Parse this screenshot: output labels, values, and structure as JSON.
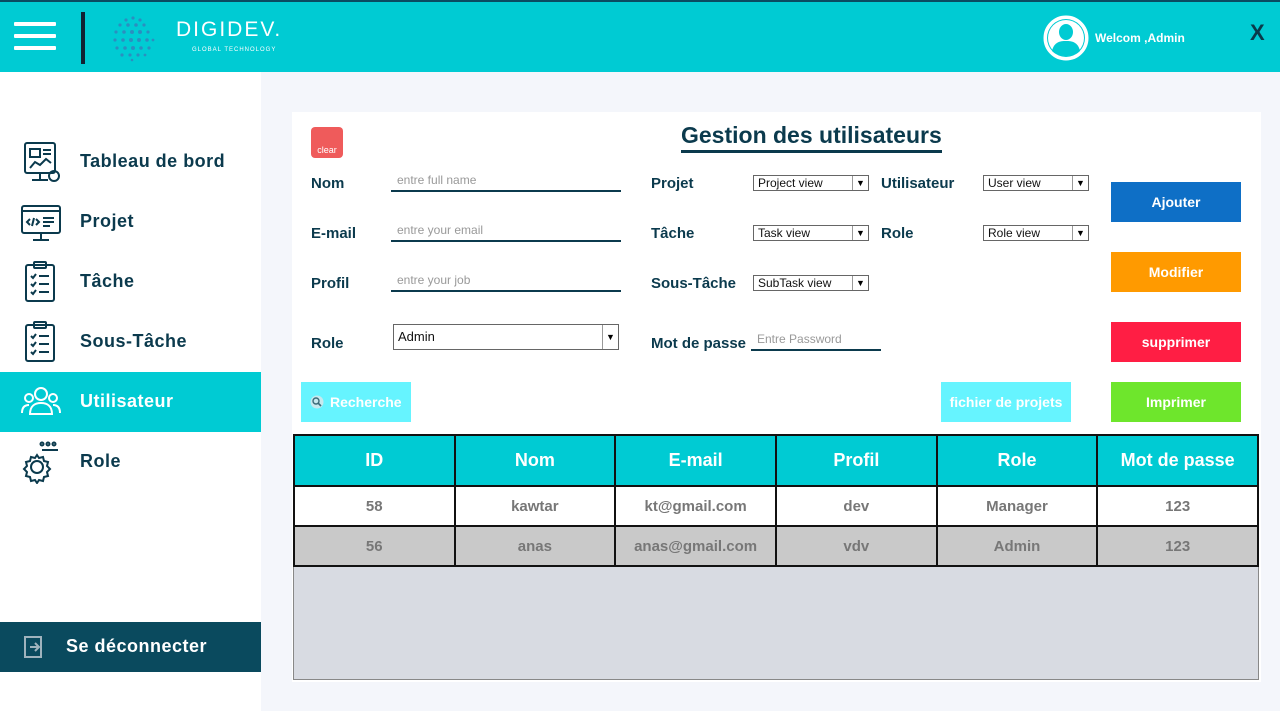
{
  "header": {
    "brand": "DIGIDEV.",
    "brand_sub": "GLOBAL TECHNOLOGY",
    "welcome": "Welcom ,Admin",
    "close": "X",
    "accent_color": "#00cbd3"
  },
  "sidebar": {
    "items": [
      {
        "label": "Tableau de bord",
        "icon": "dashboard-icon"
      },
      {
        "label": "Projet",
        "icon": "monitor-code-icon"
      },
      {
        "label": "Tâche",
        "icon": "checklist-icon"
      },
      {
        "label": "Sous-Tâche",
        "icon": "checklist-icon"
      },
      {
        "label": "Utilisateur",
        "icon": "users-icon",
        "active": true
      },
      {
        "label": "Role",
        "icon": "gear-icon"
      }
    ],
    "logout": "Se déconnecter"
  },
  "form": {
    "title": "Gestion des utilisateurs",
    "clear": "clear",
    "nom_label": "Nom",
    "nom_placeholder": "entre full name",
    "email_label": "E-mail",
    "email_placeholder": "entre your email",
    "profil_label": "Profil",
    "profil_placeholder": "entre your job",
    "role_label": "Role",
    "role_value": "Admin",
    "projet_label": "Projet",
    "projet_value": "Project view",
    "tache_label": "Tâche",
    "tache_value": "Task view",
    "soustache_label": "Sous-Tâche",
    "soustache_value": "SubTask view",
    "utilisateur_label": "Utilisateur",
    "utilisateur_value": "User view",
    "role2_label": "Role",
    "role2_value": "Role view",
    "password_label": "Mot de passe",
    "password_placeholder": "Entre Password"
  },
  "buttons": {
    "ajouter": "Ajouter",
    "modifier": "Modifier",
    "supprimer": "supprimer",
    "imprimer": "Imprimer",
    "recherche": "Recherche",
    "fichier": "fichier de projets"
  },
  "table": {
    "headers": [
      "ID",
      "Nom",
      "E-mail",
      "Profil",
      "Role",
      "Mot de passe"
    ],
    "rows": [
      [
        "58",
        "kawtar",
        "kt@gmail.com",
        "dev",
        "Manager",
        "123"
      ],
      [
        "56",
        "anas",
        "anas@gmail.com",
        "vdv",
        "Admin",
        "123"
      ]
    ]
  }
}
